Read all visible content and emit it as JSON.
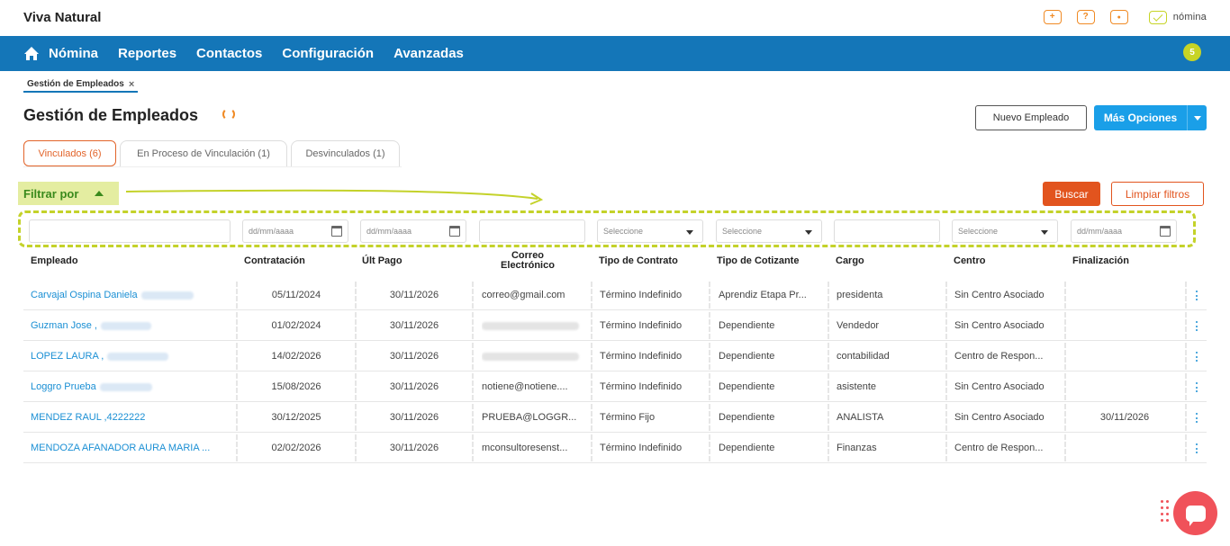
{
  "app": {
    "title": "Viva Natural",
    "brand": "nómina",
    "notification_count": "5"
  },
  "top_icons": [
    {
      "name": "add-icon",
      "glyph": "+"
    },
    {
      "name": "help-icon",
      "glyph": "?"
    },
    {
      "name": "user-icon",
      "glyph": "●"
    }
  ],
  "nav": {
    "items": [
      "Nómina",
      "Reportes",
      "Contactos",
      "Configuración",
      "Avanzadas"
    ]
  },
  "breadcrumb": {
    "label": "Gestión de Empleados",
    "close": "×"
  },
  "page": {
    "title": "Gestión de Empleados"
  },
  "actions": {
    "new_employee": "Nuevo Empleado",
    "more_options": "Más Opciones"
  },
  "tabs": [
    {
      "label": "Vinculados (6)",
      "active": true
    },
    {
      "label": "En Proceso de Vinculación (1)",
      "active": false
    },
    {
      "label": "Desvinculados (1)",
      "active": false
    }
  ],
  "filter": {
    "toggle_label": "Filtrar por",
    "search_label": "Buscar",
    "clear_label": "Limpiar filtros",
    "date_placeholder": "dd/mm/aaaa",
    "select_placeholder": "Seleccione"
  },
  "table": {
    "headers": [
      "Empleado",
      "Contratación",
      "Últ Pago",
      "Correo Electrónico",
      "Tipo de Contrato",
      "Tipo de Cotizante",
      "Cargo",
      "Centro",
      "Finalización"
    ],
    "rows": [
      {
        "empleado": "Carvajal Ospina Daniela",
        "contratacion": "05/11/2024",
        "ult_pago": "30/11/2026",
        "correo": "correo@gmail.com",
        "tipo_contrato": "Término Indefinido",
        "tipo_cotizante": "Aprendiz Etapa Pr...",
        "cargo": "presidenta",
        "centro": "Sin Centro Asociado",
        "finalizacion": ""
      },
      {
        "empleado": "Guzman Jose ,",
        "contratacion": "01/02/2024",
        "ult_pago": "30/11/2026",
        "correo": "",
        "tipo_contrato": "Término Indefinido",
        "tipo_cotizante": "Dependiente",
        "cargo": "Vendedor",
        "centro": "Sin Centro Asociado",
        "finalizacion": ""
      },
      {
        "empleado": "LOPEZ LAURA ,",
        "contratacion": "14/02/2026",
        "ult_pago": "30/11/2026",
        "correo": "",
        "tipo_contrato": "Término Indefinido",
        "tipo_cotizante": "Dependiente",
        "cargo": "contabilidad",
        "centro": "Centro de Respon...",
        "finalizacion": ""
      },
      {
        "empleado": "Loggro Prueba",
        "contratacion": "15/08/2026",
        "ult_pago": "30/11/2026",
        "correo": "notiene@notiene....",
        "tipo_contrato": "Término Indefinido",
        "tipo_cotizante": "Dependiente",
        "cargo": "asistente",
        "centro": "Sin Centro Asociado",
        "finalizacion": ""
      },
      {
        "empleado": "MENDEZ RAUL ,4222222",
        "contratacion": "30/12/2025",
        "ult_pago": "30/11/2026",
        "correo": "PRUEBA@LOGGR...",
        "tipo_contrato": "Término Fijo",
        "tipo_cotizante": "Dependiente",
        "cargo": "ANALISTA",
        "centro": "Sin Centro Asociado",
        "finalizacion": "30/11/2026"
      },
      {
        "empleado": "MENDOZA AFANADOR AURA MARIA ...",
        "contratacion": "02/02/2026",
        "ult_pago": "30/11/2026",
        "correo": "mconsultoresenst...",
        "tipo_contrato": "Término Indefinido",
        "tipo_cotizante": "Dependiente",
        "cargo": "Finanzas",
        "centro": "Centro de Respon...",
        "finalizacion": ""
      }
    ]
  },
  "colors": {
    "nav_blue": "#1476b8",
    "accent_orange": "#e2541e",
    "accent_lime": "#c7d426",
    "link_blue": "#1a8fd4",
    "chat_red": "#f0525a"
  }
}
